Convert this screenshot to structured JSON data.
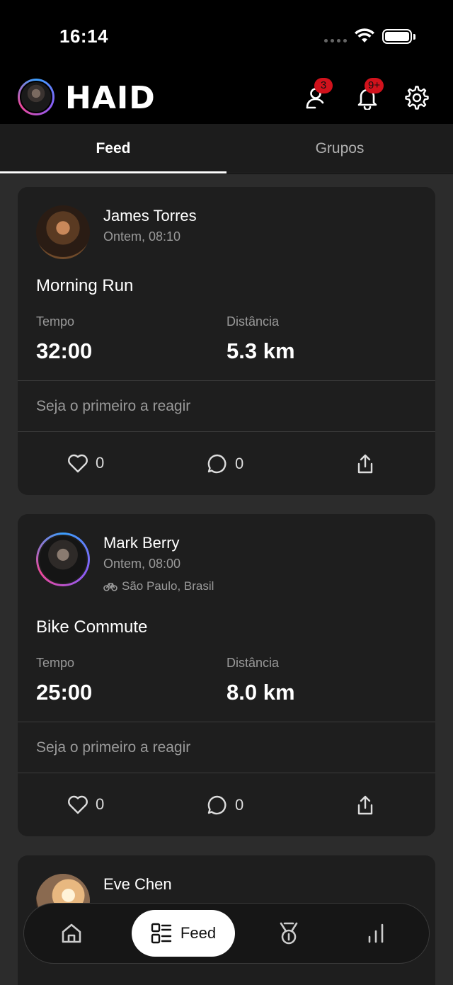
{
  "status_bar": {
    "time": "16:14"
  },
  "header": {
    "logo": "HAID",
    "friend_requests_badge": "3",
    "notifications_badge": "9+"
  },
  "tabs": [
    {
      "label": "Feed",
      "active": true
    },
    {
      "label": "Grupos",
      "active": false
    }
  ],
  "posts": [
    {
      "user": "James Torres",
      "time": "Ontem, 08:10",
      "location": "",
      "title": "Morning Run",
      "stat1_label": "Tempo",
      "stat1_value": "32:00",
      "stat2_label": "Distância",
      "stat2_value": "5.3 km",
      "reactions_text": "Seja o primeiro a reagir",
      "likes": "0",
      "comments": "0"
    },
    {
      "user": "Mark Berry",
      "time": "Ontem, 08:00",
      "location": "São Paulo, Brasil",
      "title": "Bike Commute",
      "stat1_label": "Tempo",
      "stat1_value": "25:00",
      "stat2_label": "Distância",
      "stat2_value": "8.0 km",
      "reactions_text": "Seja o primeiro a reagir",
      "likes": "0",
      "comments": "0"
    },
    {
      "user": "Eve Chen"
    }
  ],
  "bottom_nav": {
    "feed_label": "Feed",
    "items": [
      "home-icon",
      "feed-icon",
      "medal-icon",
      "stats-icon"
    ]
  },
  "colors": {
    "badge": "#d1121c",
    "card": "#1e1e1e",
    "background": "#2c2c2c"
  }
}
